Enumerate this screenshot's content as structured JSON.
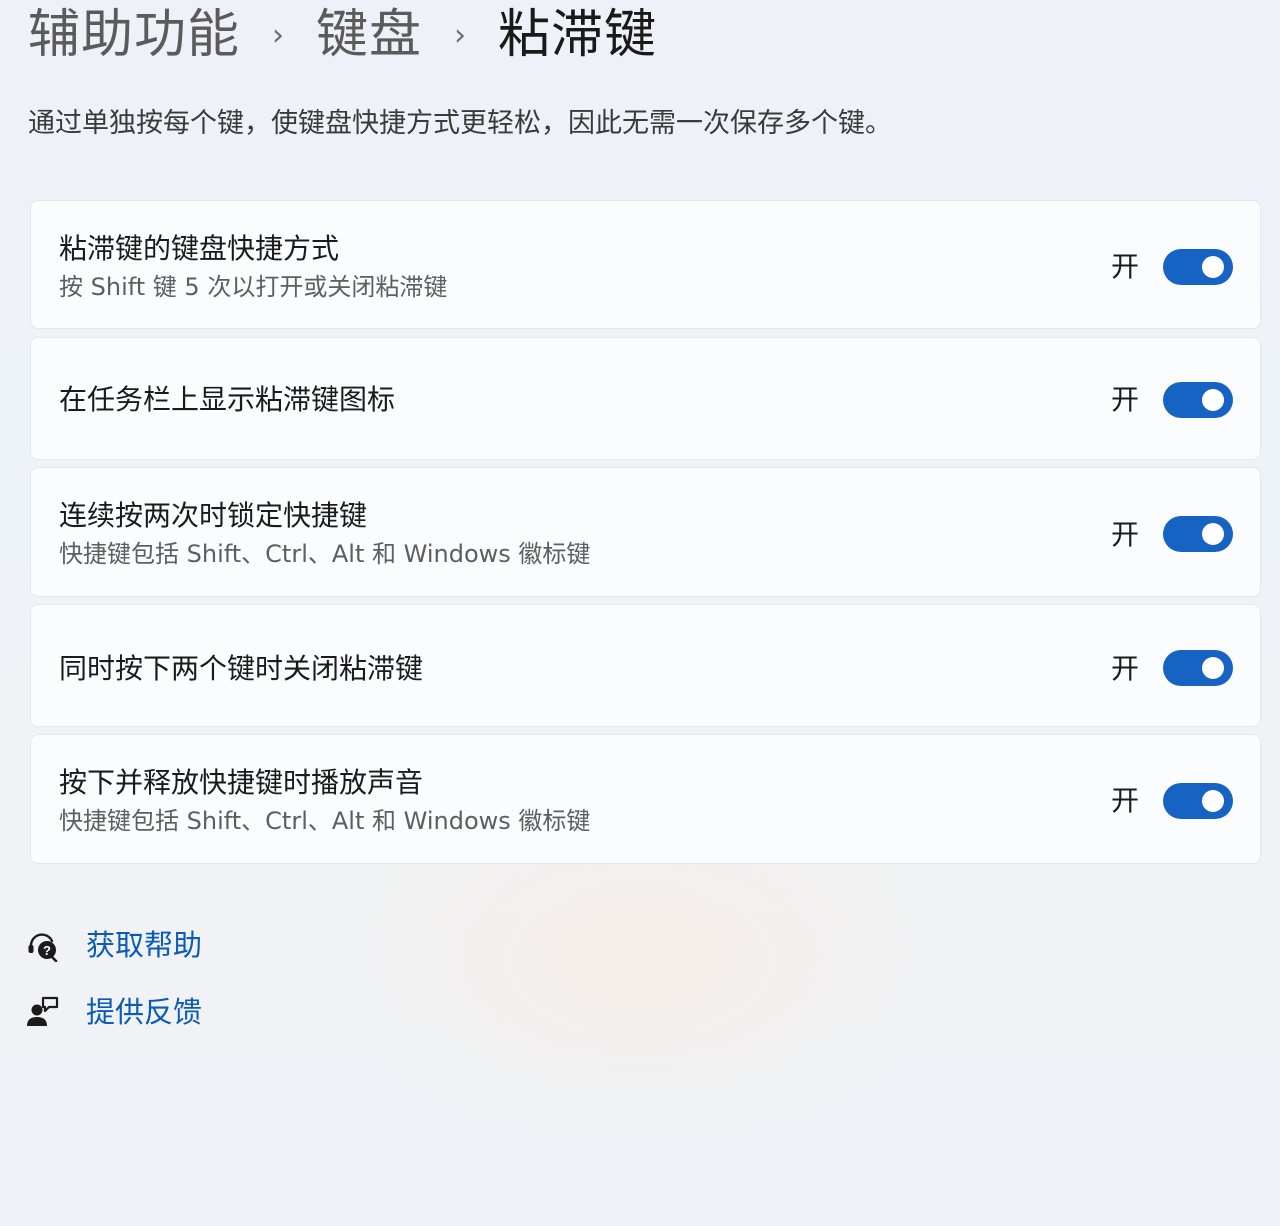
{
  "breadcrumb": {
    "items": [
      "辅助功能",
      "键盘",
      "粘滞键"
    ],
    "separator": "›"
  },
  "description": "通过单独按每个键，使键盘快捷方式更轻松，因此无需一次保存多个键。",
  "settings": [
    {
      "title": "粘滞键的键盘快捷方式",
      "subtitle": "按 Shift 键 5 次以打开或关闭粘滞键",
      "state_label": "开",
      "enabled": true
    },
    {
      "title": "在任务栏上显示粘滞键图标",
      "subtitle": "",
      "state_label": "开",
      "enabled": true
    },
    {
      "title": "连续按两次时锁定快捷键",
      "subtitle": "快捷键包括 Shift、Ctrl、Alt 和 Windows 徽标键",
      "state_label": "开",
      "enabled": true
    },
    {
      "title": "同时按下两个键时关闭粘滞键",
      "subtitle": "",
      "state_label": "开",
      "enabled": true
    },
    {
      "title": "按下并释放快捷键时播放声音",
      "subtitle": "快捷键包括 Shift、Ctrl、Alt 和 Windows 徽标键",
      "state_label": "开",
      "enabled": true
    }
  ],
  "links": [
    {
      "label": "获取帮助",
      "icon": "help-icon"
    },
    {
      "label": "提供反馈",
      "icon": "feedback-icon"
    }
  ],
  "colors": {
    "accent": "#1763c4",
    "link": "#0a5ab8"
  }
}
